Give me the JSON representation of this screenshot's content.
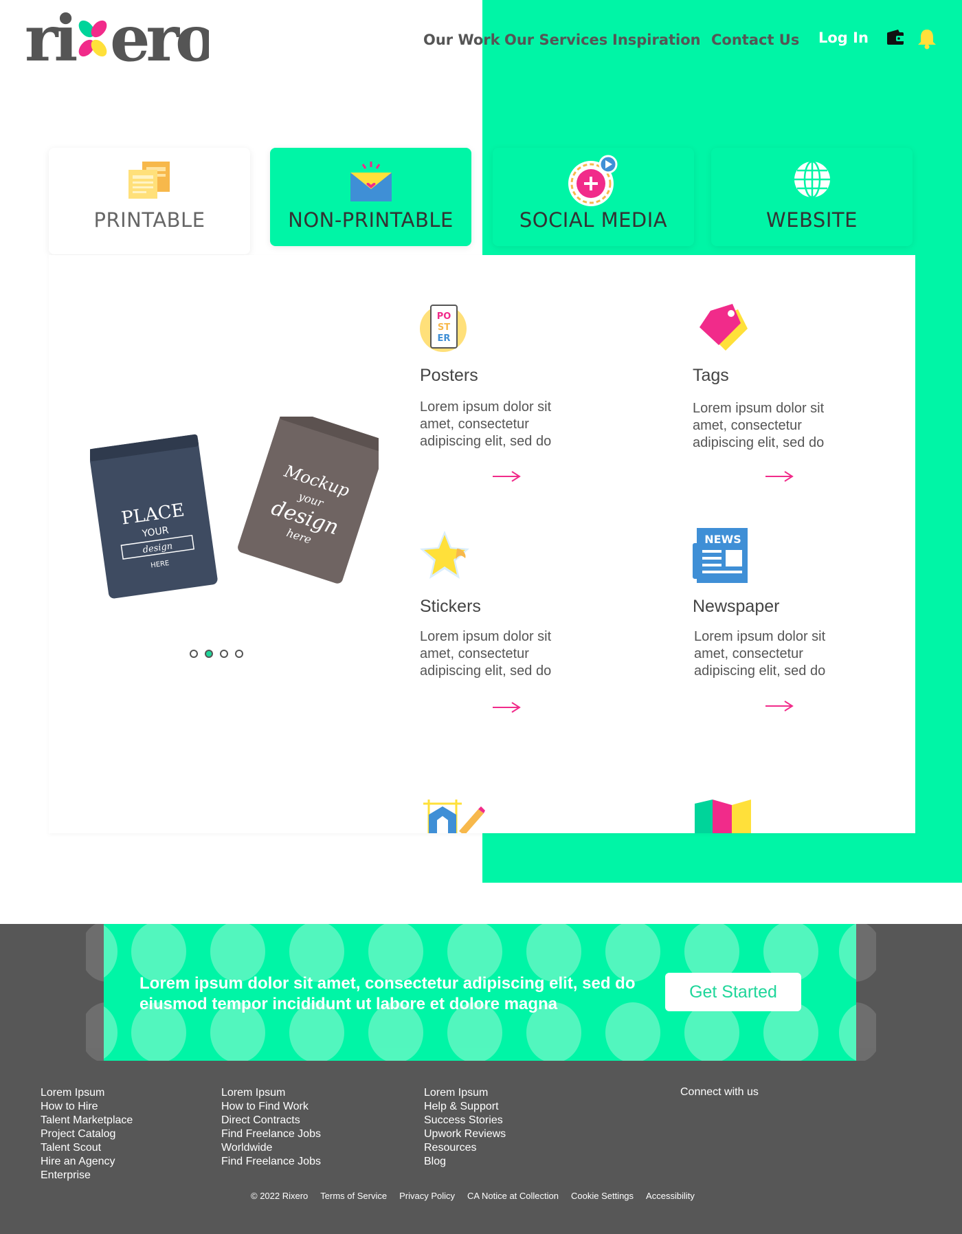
{
  "brand": {
    "logo_text": "rixero",
    "colors": {
      "green": "#00f5a6",
      "dark": "#575757",
      "pink": "#f12b8a",
      "yellow": "#ffe03a"
    }
  },
  "header": {
    "nav": [
      "Our Work",
      "Our Services",
      "Inspiration",
      "Contact Us"
    ],
    "login": "Log In",
    "icons": [
      "wallet-icon",
      "bell-icon"
    ]
  },
  "tabs": [
    {
      "label": "PRINTABLE",
      "icon": "printable-icon",
      "selected": true
    },
    {
      "label": "NON-PRINTABLE",
      "icon": "envelope-icon"
    },
    {
      "label": "SOCIAL MEDIA",
      "icon": "social-media-icon"
    },
    {
      "label": "WEBSITE",
      "icon": "globe-icon"
    }
  ],
  "carousel": {
    "image": "pouch-mockup",
    "slides": 4,
    "active_slide": 2
  },
  "cards": [
    {
      "title": "Posters",
      "desc": "Lorem ipsum dolor sit amet, consectetur adipiscing elit, sed do",
      "icon": "poster-icon"
    },
    {
      "title": "Tags",
      "desc": "Lorem ipsum dolor sit amet, consectetur adipiscing elit, sed do",
      "icon": "tag-icon"
    },
    {
      "title": "Stickers",
      "desc": "Lorem ipsum dolor sit amet, consectetur adipiscing elit, sed do",
      "icon": "sticker-icon"
    },
    {
      "title": "Newspaper",
      "desc": "Lorem ipsum dolor sit amet, consectetur adipiscing elit, sed do",
      "icon": "newspaper-icon"
    }
  ],
  "cta": {
    "text": "Lorem ipsum dolor sit amet, consectetur adipiscing elit, sed do eiusmod tempor incididunt ut labore et dolore magna",
    "button": "Get Started"
  },
  "footer": {
    "col1": [
      "Lorem Ipsum",
      "How to Hire",
      "Talent Marketplace",
      "Project Catalog",
      "Talent Scout",
      "Hire an Agency",
      "Enterprise"
    ],
    "col2": [
      "Lorem Ipsum",
      "How to Find Work",
      "Direct Contracts",
      "Find Freelance Jobs",
      "Worldwide",
      "Find Freelance Jobs"
    ],
    "col3": [
      "Lorem Ipsum",
      "Help & Support",
      "Success Stories",
      "Upwork Reviews",
      "Resources",
      "Blog"
    ],
    "connect": "Connect with us",
    "legal": [
      "© 2022 Rixero",
      "Terms of Service",
      "Privacy Policy",
      "CA Notice at Collection",
      "Cookie Settings",
      "Accessibility"
    ]
  }
}
